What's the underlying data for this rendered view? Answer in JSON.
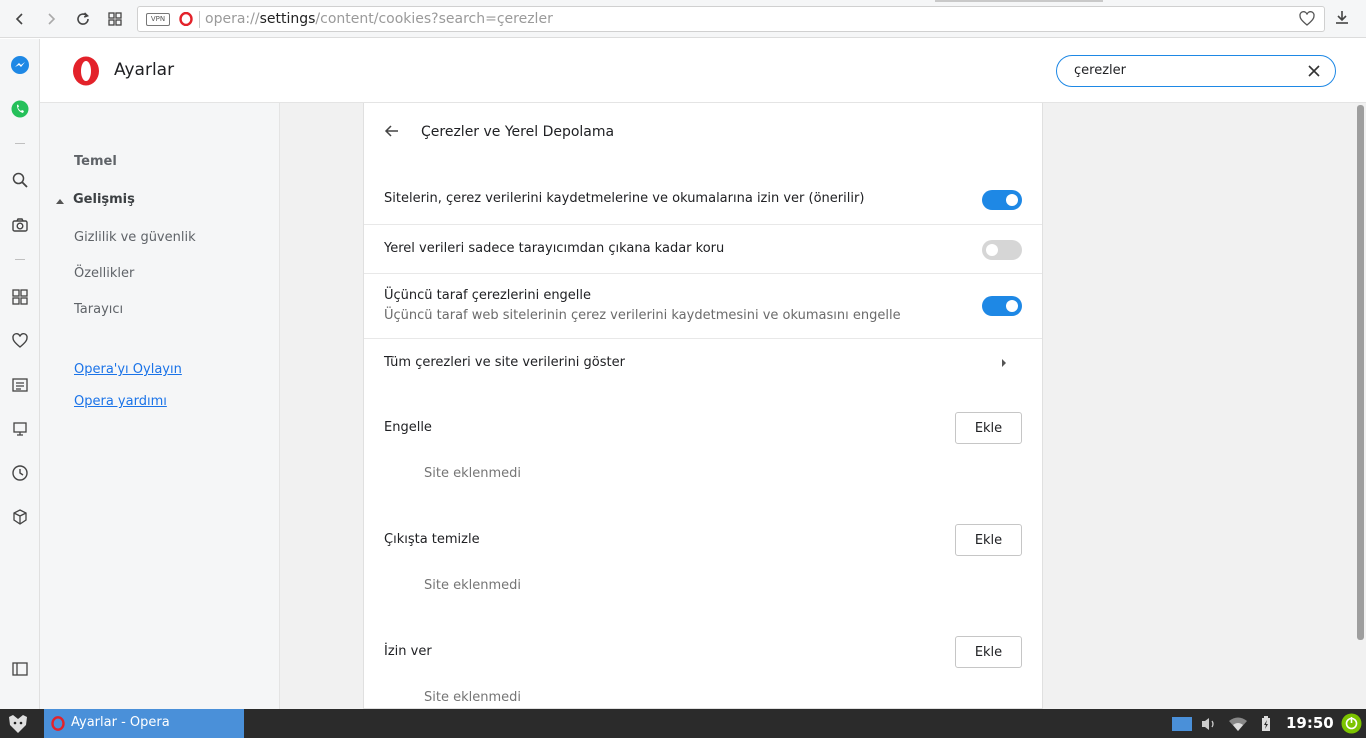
{
  "browser": {
    "url_prefix": "opera://",
    "url_host": "settings",
    "url_path": "/content/cookies?search=çerezler",
    "vpn_label": "VPN"
  },
  "header": {
    "title": "Ayarlar",
    "search_value": "çerezler"
  },
  "nav": {
    "basic": "Temel",
    "advanced": "Gelişmiş",
    "privacy": "Gizlilik ve güvenlik",
    "features": "Özellikler",
    "browser": "Tarayıcı",
    "rate": "Opera'yı Oylayın",
    "help": "Opera yardımı"
  },
  "panel": {
    "title": "Çerezler ve Yerel Depolama",
    "settings": [
      {
        "label": "Sitelerin, çerez verilerini kaydetmelerine ve okumalarına izin ver (önerilir)",
        "enabled": true
      },
      {
        "label": "Yerel verileri sadece tarayıcımdan çıkana kadar koru",
        "enabled": false
      },
      {
        "label": "Üçüncü taraf çerezlerini engelle",
        "sublabel": "Üçüncü taraf web sitelerinin çerez verilerini kaydetmesini ve okumasını engelle",
        "enabled": true
      }
    ],
    "show_all": "Tüm çerezleri ve site verilerini göster",
    "sections": [
      {
        "label": "Engelle",
        "button": "Ekle",
        "empty": "Site eklenmedi"
      },
      {
        "label": "Çıkışta temizle",
        "button": "Ekle",
        "empty": "Site eklenmedi"
      },
      {
        "label": "İzin ver",
        "button": "Ekle",
        "empty": "Site eklenmedi"
      }
    ]
  },
  "taskbar": {
    "window_title": "Ayarlar - Opera",
    "clock": "19:50"
  },
  "colors": {
    "accent": "#1e88e5",
    "opera_red": "#e3222a",
    "taskbar": "#2b2b2b",
    "task_active": "#4a90d9"
  }
}
